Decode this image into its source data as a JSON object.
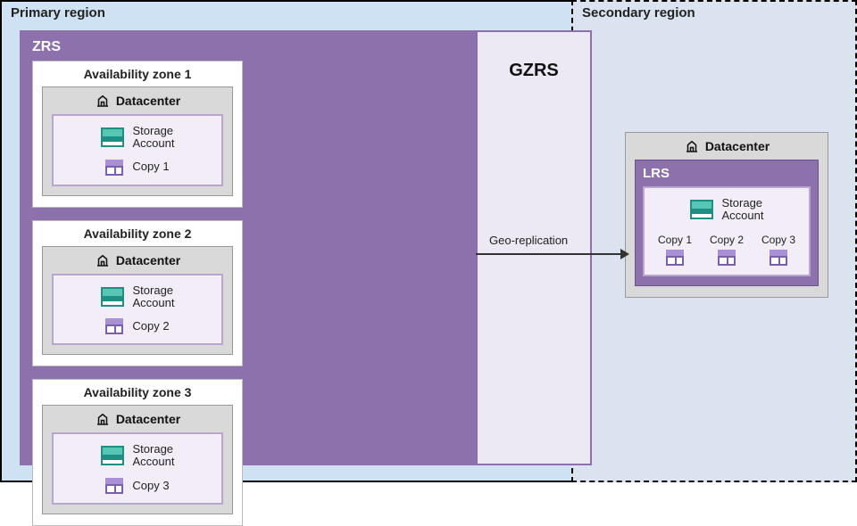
{
  "title": "GZRS",
  "primary": {
    "label": "Primary region",
    "zrs_label": "ZRS",
    "zones": [
      {
        "title": "Availability zone 1",
        "dc": "Datacenter",
        "sa": "Storage\nAccount",
        "copy": "Copy 1"
      },
      {
        "title": "Availability zone 2",
        "dc": "Datacenter",
        "sa": "Storage\nAccount",
        "copy": "Copy 2"
      },
      {
        "title": "Availability zone 3",
        "dc": "Datacenter",
        "sa": "Storage\nAccount",
        "copy": "Copy 3"
      }
    ]
  },
  "secondary": {
    "label": "Secondary region",
    "dc": "Datacenter",
    "lrs_label": "LRS",
    "sa": "Storage\nAccount",
    "copies": [
      "Copy 1",
      "Copy 2",
      "Copy 3"
    ]
  },
  "geo_label": "Geo-replication"
}
